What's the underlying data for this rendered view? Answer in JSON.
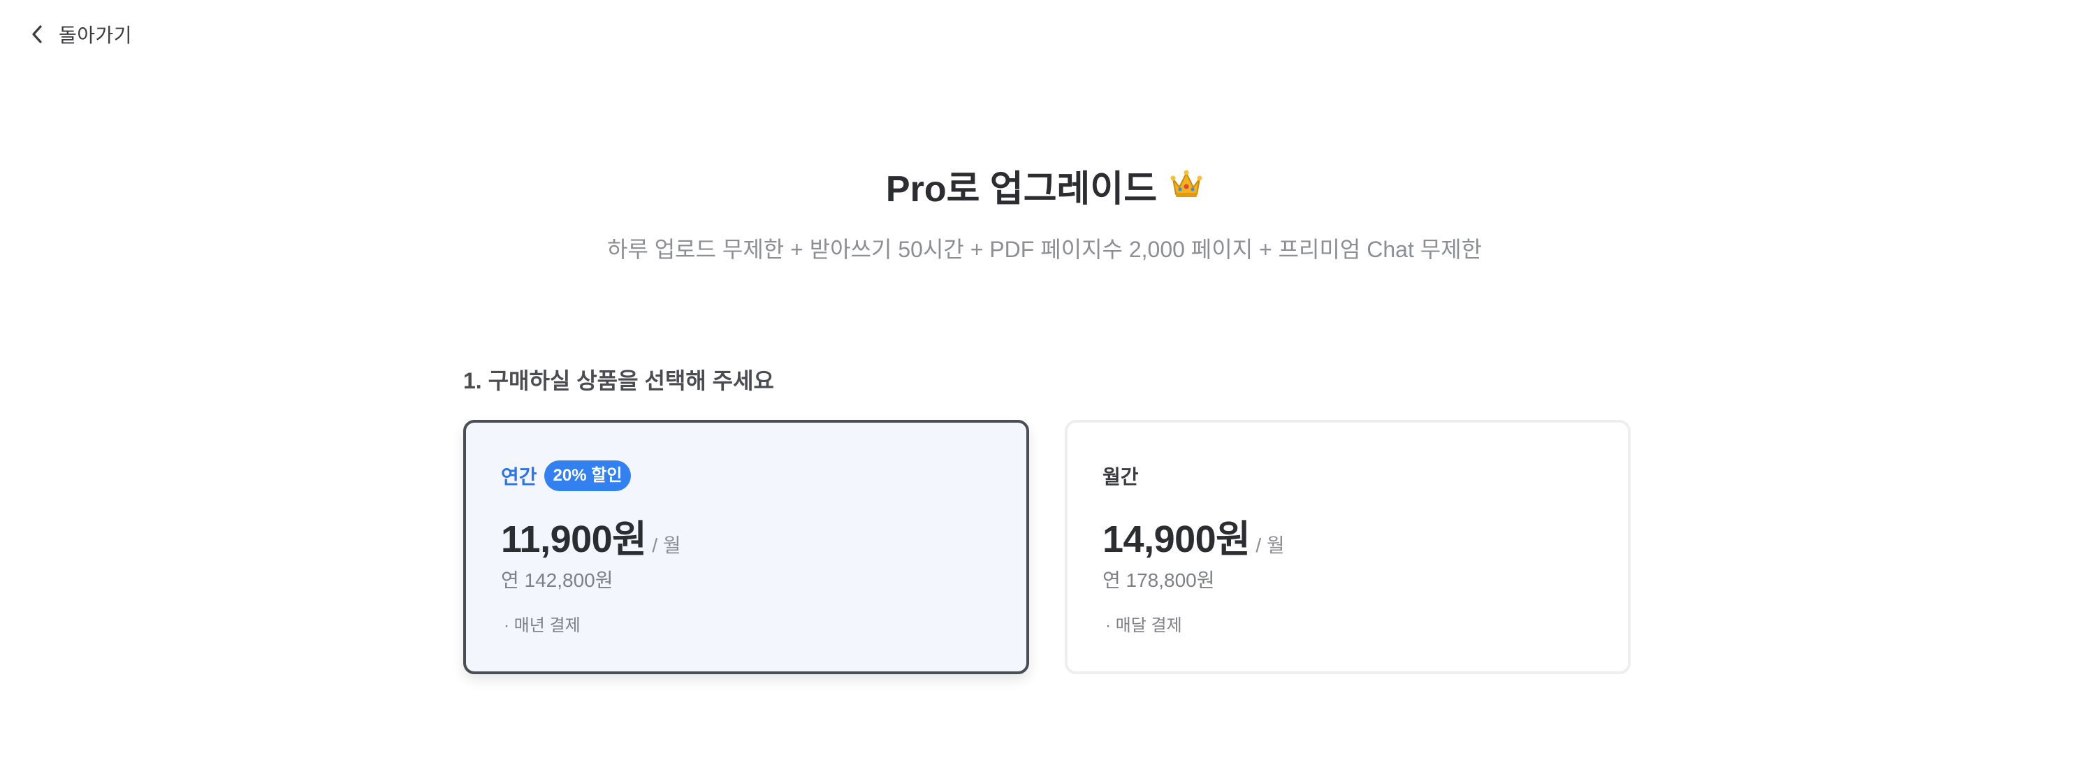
{
  "nav": {
    "back_label": "돌아가기"
  },
  "hero": {
    "title": "Pro로 업그레이드",
    "title_icon": "crown-icon",
    "subtitle": "하루 업로드 무제한 + 받아쓰기 50시간 + PDF 페이지수 2,000 페이지 + 프리미엄 Chat 무제한"
  },
  "section": {
    "heading": "1. 구매하실 상품을 선택해 주세요"
  },
  "plans": [
    {
      "name": "연간",
      "badge": "20% 할인",
      "price": "11,900원",
      "per": "/ 월",
      "yearly_total": "연 142,800원",
      "billing": "· 매년 결제",
      "selected": true
    },
    {
      "name": "월간",
      "price": "14,900원",
      "per": "/ 월",
      "yearly_total": "연 178,800원",
      "billing": "· 매달 결제",
      "selected": false
    }
  ],
  "colors": {
    "accent": "#2f74e4",
    "badge_bg": "#3380f0",
    "selected_card_bg": "#f3f6fc",
    "selected_border": "#4a4d55",
    "muted_text": "#8b8e93"
  }
}
